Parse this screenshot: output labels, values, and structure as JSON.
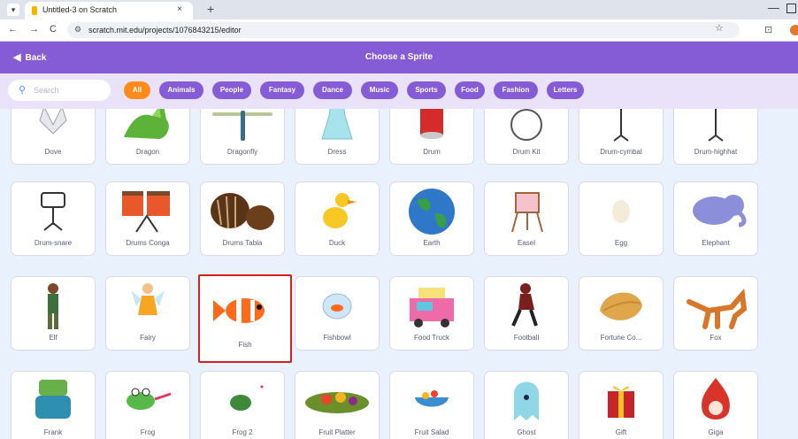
{
  "browser": {
    "tab_title": "Untitled-3 on Scratch",
    "tab_close": "×",
    "new_tab": "+",
    "url": "scratch.mit.edu/projects/1076843215/editor",
    "back_glyph": "←",
    "forward_glyph": "→",
    "reload_glyph": "C",
    "minimize_glyph": "—"
  },
  "header": {
    "back_label": "Back",
    "title": "Choose a Sprite"
  },
  "search": {
    "placeholder": "Search"
  },
  "filters": [
    "All",
    "Animals",
    "People",
    "Fantasy",
    "Dance",
    "Music",
    "Sports",
    "Food",
    "Fashion",
    "Letters"
  ],
  "active_filter": "All",
  "rows": [
    [
      "Dove",
      "Dragon",
      "Dragonfly",
      "Dress",
      "Drum",
      "Drum Kit",
      "Drum-cymbal",
      "Drum-highhat"
    ],
    [
      "Drum-snare",
      "Drums Conga",
      "Drums Tabla",
      "Duck",
      "Earth",
      "Easel",
      "Egg",
      "Elephant"
    ],
    [
      "Elf",
      "Fairy",
      "Fish",
      "Fishbowl",
      "Food Truck",
      "Football",
      "Fortune Co...",
      "Fox"
    ],
    [
      "Frank",
      "Frog",
      "Frog 2",
      "Fruit Platter",
      "Fruit Salad",
      "Ghost",
      "Gift",
      "Giga"
    ]
  ],
  "selected_sprite": "Fish",
  "colors": {
    "header": "#855cd6",
    "active_filter": "#ff8c1a",
    "selection": "#d91e1e"
  }
}
